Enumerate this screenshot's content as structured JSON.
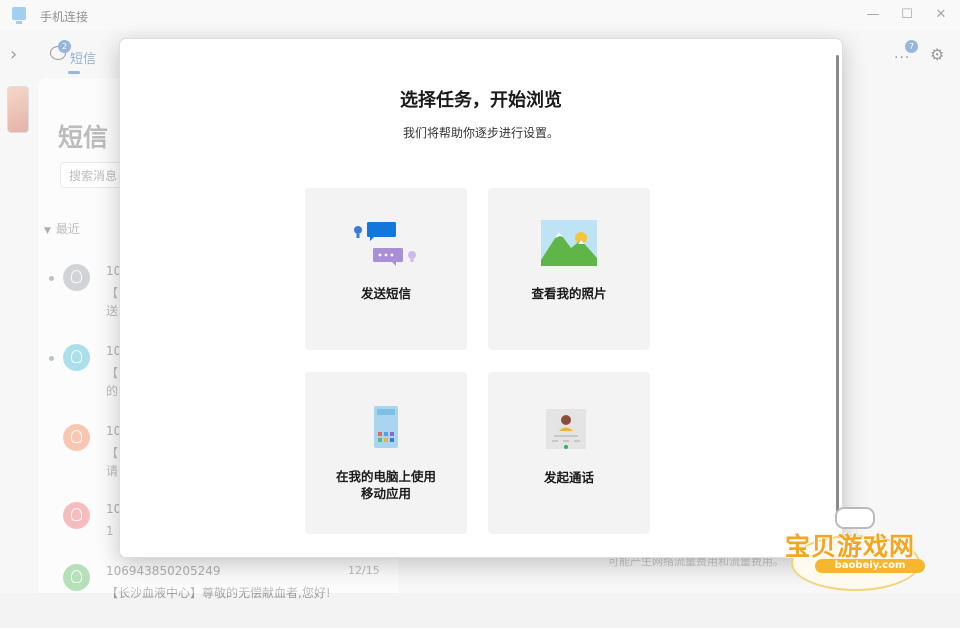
{
  "window": {
    "title": "手机连接",
    "minimize": "—",
    "maximize": "☐",
    "close": "✕"
  },
  "nav": {
    "expand": "›",
    "messages_tab": {
      "label": "短信",
      "badge": "2"
    },
    "more": "...",
    "more_badge": "7",
    "settings": "⚙"
  },
  "panel": {
    "title": "短信",
    "search_placeholder": "搜索消息",
    "recent_label": "最近",
    "items": [
      {
        "from": "10",
        "preview": "【\n送",
        "date": "",
        "avatar_color": "#b9bcc2",
        "unread": true
      },
      {
        "from": "10",
        "preview": "【\n的",
        "date": "",
        "avatar_color": "#7fd0e0",
        "unread": true
      },
      {
        "from": "10",
        "preview": "【\n请",
        "date": "",
        "avatar_color": "#f5a98a",
        "unread": false
      },
      {
        "from": "10",
        "preview": "1",
        "date": "",
        "avatar_color": "#f29a9c",
        "unread": false
      },
      {
        "from": "106943850205249",
        "preview": "【长沙血液中心】尊敬的无偿献血者,您好!",
        "date": "12/15",
        "avatar_color": "#8fcf94",
        "unread": false
      }
    ]
  },
  "right_hint": "可能产生网络流量费用和流量费用。",
  "dialog": {
    "title": "选择任务，开始浏览",
    "subtitle": "我们将帮助你逐步进行设置。",
    "cards": [
      {
        "label": "发送短信",
        "icon": "messages-icon"
      },
      {
        "label": "查看我的照片",
        "icon": "photos-icon"
      },
      {
        "label": "在我的电脑上使用\n移动应用",
        "icon": "apps-icon"
      },
      {
        "label": "发起通话",
        "icon": "calls-icon"
      }
    ]
  },
  "watermark": {
    "text": "宝贝游戏网",
    "url": "baobeiy.com"
  }
}
